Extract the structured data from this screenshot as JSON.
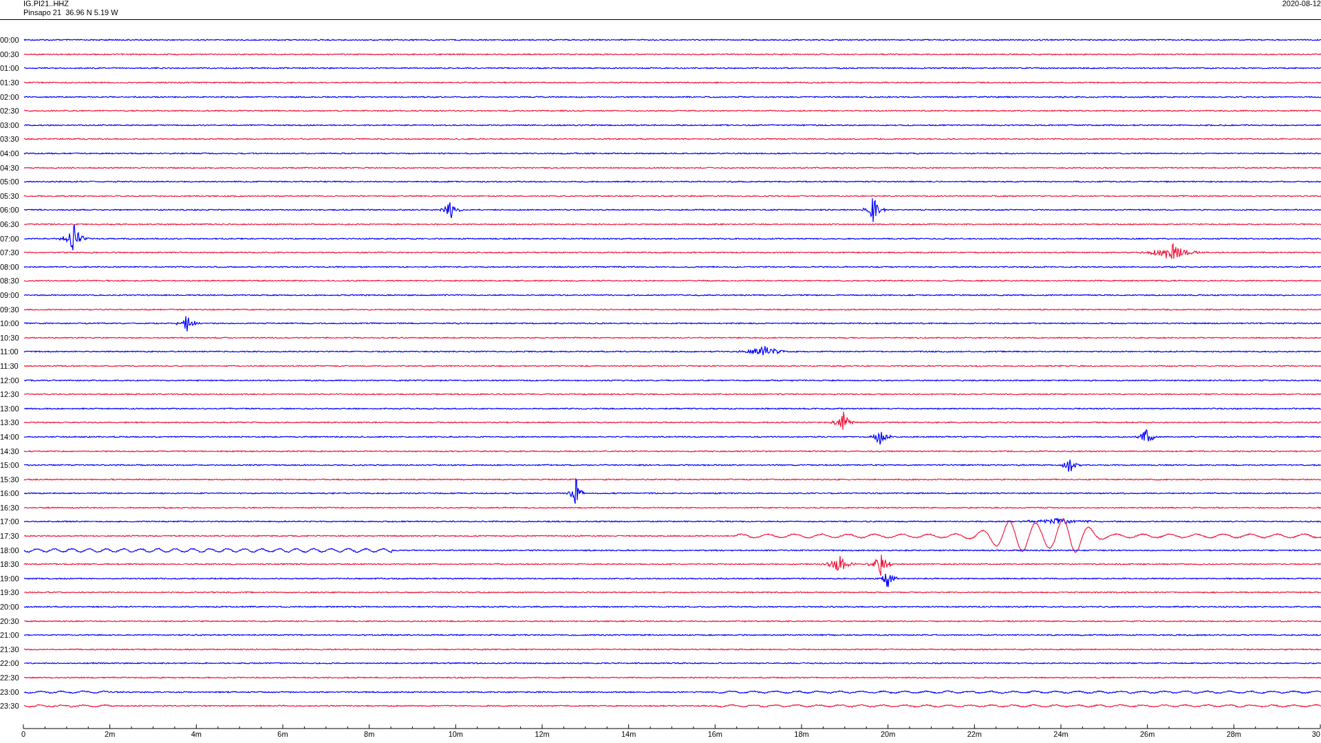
{
  "header": {
    "station": "IG.PI21..HHZ",
    "location": "Pinsapo 21  36.96 N 5.19 W",
    "date": "2020-08-12"
  },
  "rows": [
    {
      "time": "00:00",
      "color": "#0000ff"
    },
    {
      "time": "00:30",
      "color": "#f0183c"
    },
    {
      "time": "01:00",
      "color": "#0000ff"
    },
    {
      "time": "01:30",
      "color": "#f0183c"
    },
    {
      "time": "02:00",
      "color": "#0000ff"
    },
    {
      "time": "02:30",
      "color": "#f0183c"
    },
    {
      "time": "03:00",
      "color": "#0000ff"
    },
    {
      "time": "03:30",
      "color": "#f0183c"
    },
    {
      "time": "04:00",
      "color": "#0000ff"
    },
    {
      "time": "04:30",
      "color": "#f0183c"
    },
    {
      "time": "05:00",
      "color": "#0000ff"
    },
    {
      "time": "05:30",
      "color": "#f0183c"
    },
    {
      "time": "06:00",
      "color": "#0000ff"
    },
    {
      "time": "06:30",
      "color": "#f0183c"
    },
    {
      "time": "07:00",
      "color": "#0000ff"
    },
    {
      "time": "07:30",
      "color": "#f0183c"
    },
    {
      "time": "08:00",
      "color": "#0000ff"
    },
    {
      "time": "08:30",
      "color": "#f0183c"
    },
    {
      "time": "09:00",
      "color": "#0000ff"
    },
    {
      "time": "09:30",
      "color": "#f0183c"
    },
    {
      "time": "10:00",
      "color": "#0000ff"
    },
    {
      "time": "10:30",
      "color": "#f0183c"
    },
    {
      "time": "11:00",
      "color": "#0000ff"
    },
    {
      "time": "11:30",
      "color": "#f0183c"
    },
    {
      "time": "12:00",
      "color": "#0000ff"
    },
    {
      "time": "12:30",
      "color": "#f0183c"
    },
    {
      "time": "13:00",
      "color": "#0000ff"
    },
    {
      "time": "13:30",
      "color": "#f0183c"
    },
    {
      "time": "14:00",
      "color": "#0000ff"
    },
    {
      "time": "14:30",
      "color": "#f0183c"
    },
    {
      "time": "15:00",
      "color": "#0000ff"
    },
    {
      "time": "15:30",
      "color": "#f0183c"
    },
    {
      "time": "16:00",
      "color": "#0000ff"
    },
    {
      "time": "16:30",
      "color": "#f0183c"
    },
    {
      "time": "17:00",
      "color": "#0000ff"
    },
    {
      "time": "17:30",
      "color": "#f0183c"
    },
    {
      "time": "18:00",
      "color": "#0000ff"
    },
    {
      "time": "18:30",
      "color": "#f0183c"
    },
    {
      "time": "19:00",
      "color": "#0000ff"
    },
    {
      "time": "19:30",
      "color": "#f0183c"
    },
    {
      "time": "20:00",
      "color": "#0000ff"
    },
    {
      "time": "20:30",
      "color": "#f0183c"
    },
    {
      "time": "21:00",
      "color": "#0000ff"
    },
    {
      "time": "21:30",
      "color": "#f0183c"
    },
    {
      "time": "22:00",
      "color": "#0000ff"
    },
    {
      "time": "22:30",
      "color": "#f0183c"
    },
    {
      "time": "23:00",
      "color": "#0000ff"
    },
    {
      "time": "23:30",
      "color": "#f0183c"
    }
  ],
  "axis": {
    "ticks": [
      "0",
      "2m",
      "4m",
      "6m",
      "8m",
      "10m",
      "12m",
      "14m",
      "16m",
      "18m",
      "20m",
      "22m",
      "24m",
      "26m",
      "28m",
      "30"
    ]
  }
}
